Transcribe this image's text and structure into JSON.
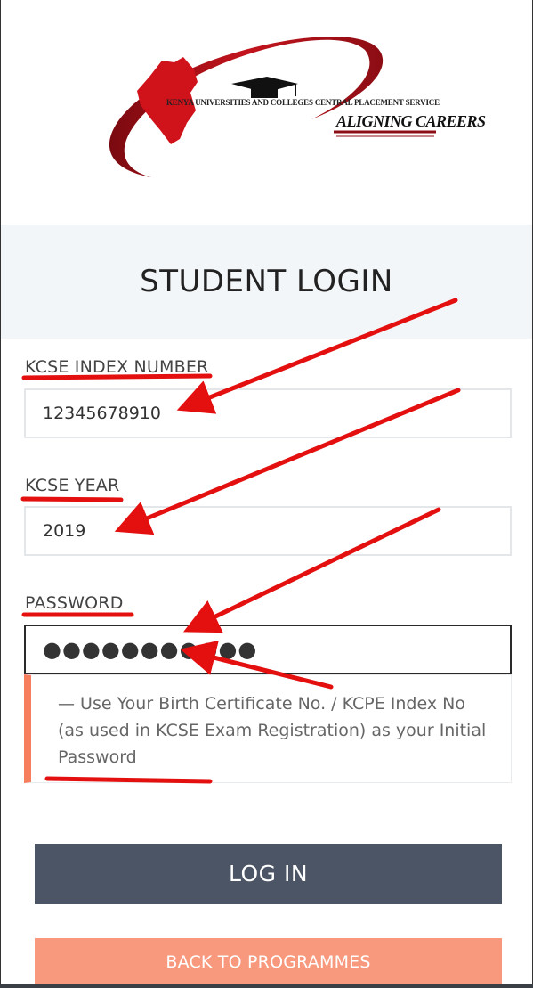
{
  "logo": {
    "org_name": "KENYA UNIVERSITIES AND COLLEGES CENTRAL PLACEMENT SERVICE",
    "tagline": "ALIGNING CAREERS",
    "primary_color": "#b3121b"
  },
  "page_title": "STUDENT LOGIN",
  "form": {
    "index_label": "KCSE INDEX NUMBER",
    "index_value": "12345678910",
    "year_label": "KCSE YEAR",
    "year_value": "2019",
    "password_label": "PASSWORD",
    "password_mask": "●●●●●●●●●●●",
    "password_hint": "— Use Your Birth Certificate No. / KCPE Index No (as used in KCSE Exam Registration) as your Initial Password"
  },
  "buttons": {
    "login": "LOG IN",
    "back": "BACK TO PROGRAMMES"
  },
  "colors": {
    "annotation": "#e41010",
    "hint_accent": "#f77e5d",
    "login_bg": "#4c5565",
    "back_bg": "#f8987c"
  }
}
